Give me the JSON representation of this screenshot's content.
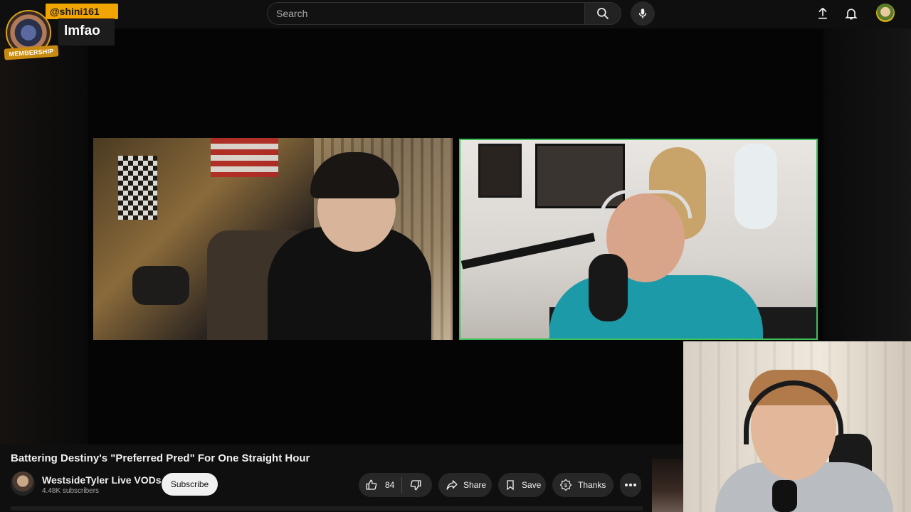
{
  "header": {
    "search_placeholder": "Search",
    "icons": [
      "search-icon",
      "mic-icon",
      "upload-icon",
      "bell-icon",
      "avatar"
    ]
  },
  "super_chat": {
    "username": "@shini161",
    "message": "lmfao",
    "badge": "MEMBERSHIP",
    "color": "#f2a500"
  },
  "video": {
    "title": "Battering Destiny's \"Preferred Pred\" For One Straight Hour"
  },
  "channel": {
    "name": "WestsideTyler Live VODs",
    "subscribers": "4.48K subscribers",
    "subscribe_label": "Subscribe"
  },
  "actions": {
    "like_count": "84",
    "share_label": "Share",
    "save_label": "Save",
    "thanks_label": "Thanks"
  },
  "colors": {
    "active_speaker_border": "#3fbf5a",
    "background": "#0f0f0f"
  }
}
